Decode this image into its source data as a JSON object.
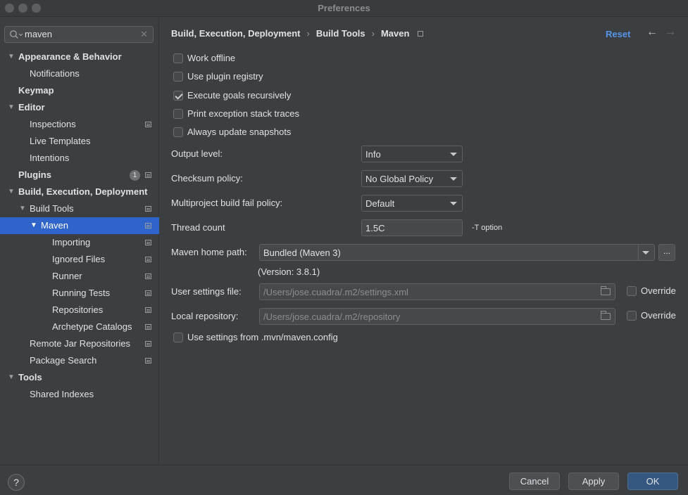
{
  "window": {
    "title": "Preferences"
  },
  "search": {
    "value": "maven",
    "clear": "✕"
  },
  "sidebar": {
    "items": [
      {
        "label": "Appearance & Behavior",
        "bold": true
      },
      {
        "label": "Notifications"
      },
      {
        "label": "Keymap",
        "bold": true
      },
      {
        "label": "Editor",
        "bold": true
      },
      {
        "label": "Inspections"
      },
      {
        "label": "Live Templates"
      },
      {
        "label": "Intentions"
      },
      {
        "label": "Plugins",
        "bold": true,
        "badge": "1"
      },
      {
        "label": "Build, Execution, Deployment",
        "bold": true
      },
      {
        "label": "Build Tools"
      },
      {
        "label": "Maven"
      },
      {
        "label": "Importing"
      },
      {
        "label": "Ignored Files"
      },
      {
        "label": "Runner"
      },
      {
        "label": "Running Tests"
      },
      {
        "label": "Repositories"
      },
      {
        "label": "Archetype Catalogs"
      },
      {
        "label": "Remote Jar Repositories"
      },
      {
        "label": "Package Search"
      },
      {
        "label": "Tools",
        "bold": true
      },
      {
        "label": "Shared Indexes"
      }
    ]
  },
  "breadcrumb": {
    "part1": "Build, Execution, Deployment",
    "sep": "›",
    "part2": "Build Tools",
    "part3": "Maven"
  },
  "header": {
    "reset": "Reset",
    "back": "←",
    "forward": "→"
  },
  "options": {
    "work_offline": "Work offline",
    "use_plugin_registry": "Use plugin registry",
    "execute_goals_recursively": "Execute goals recursively",
    "print_exception_stack_traces": "Print exception stack traces",
    "always_update_snapshots": "Always update snapshots",
    "use_settings_from_mvn": "Use settings from .mvn/maven.config"
  },
  "output_level": {
    "label": "Output level:",
    "value": "Info"
  },
  "checksum_policy": {
    "label": "Checksum policy:",
    "value": "No Global Policy"
  },
  "multiproject": {
    "label": "Multiproject build fail policy:",
    "value": "Default"
  },
  "thread_count": {
    "label": "Thread count",
    "value": "1.5C",
    "hint": "-T option"
  },
  "maven_home": {
    "label": "Maven home path:",
    "value": "Bundled (Maven 3)",
    "browse": "...",
    "version": "(Version: 3.8.1)"
  },
  "user_settings": {
    "label": "User settings file:",
    "value": "/Users/jose.cuadra/.m2/settings.xml",
    "override": "Override"
  },
  "local_repo": {
    "label": "Local repository:",
    "value": "/Users/jose.cuadra/.m2/repository",
    "override": "Override"
  },
  "footer": {
    "help": "?",
    "cancel": "Cancel",
    "apply": "Apply",
    "ok": "OK"
  },
  "colors": {
    "selection": "#2f65ca",
    "link": "#5894e9",
    "primary_button": "#365880"
  }
}
